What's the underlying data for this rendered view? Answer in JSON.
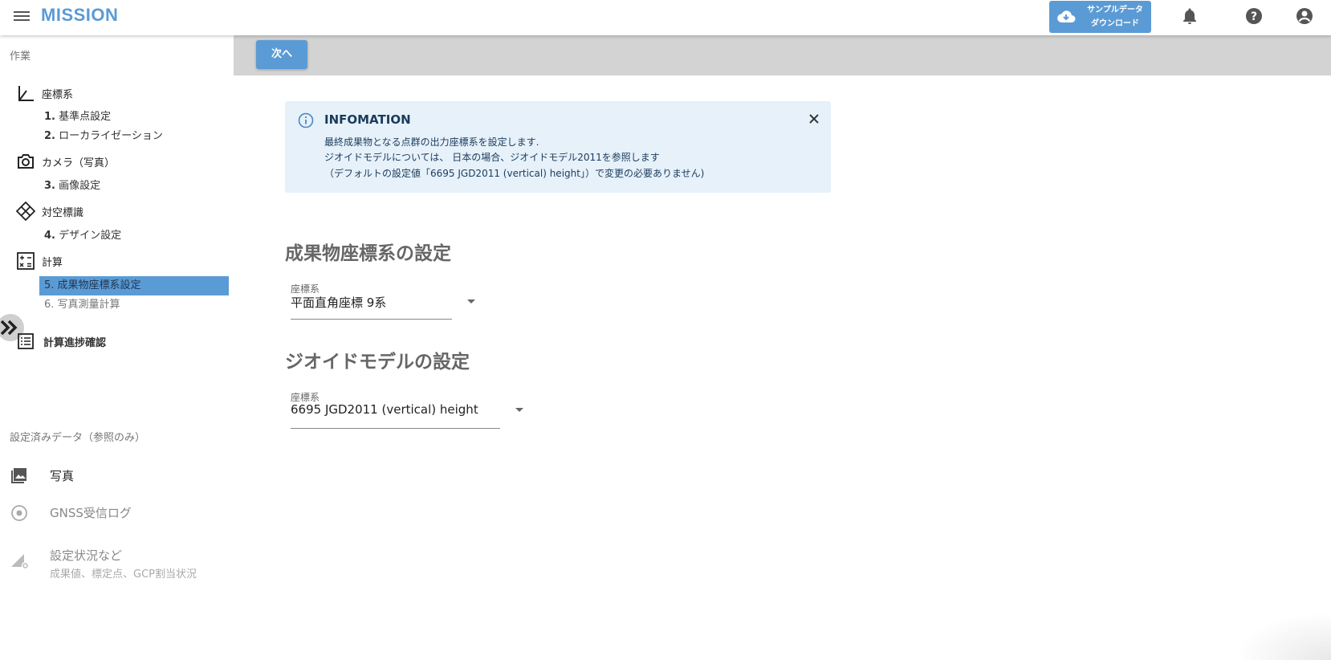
{
  "header": {
    "logo": "MISSION",
    "download_line1": "サンプルデータ",
    "download_line2": "ダウンロード",
    "icons": [
      "menu-icon",
      "cloud-download-icon",
      "bell-icon",
      "help-icon",
      "account-icon"
    ]
  },
  "sidebar": {
    "section_label": "作業",
    "groups": [
      {
        "icon": "coordinate-axes-icon",
        "label": "座標系"
      },
      {
        "icon": "camera-icon",
        "label": "カメラ（写真）"
      },
      {
        "icon": "target-marker-icon",
        "label": "対空標識"
      },
      {
        "icon": "calculator-icon",
        "label": "計算"
      }
    ],
    "steps": [
      {
        "num": "1.",
        "label": "基準点設定"
      },
      {
        "num": "2.",
        "label": "ローカライゼーション"
      },
      {
        "num": "3.",
        "label": "画像設定"
      },
      {
        "num": "4.",
        "label": "デザイン設定"
      },
      {
        "num": "5.",
        "label": "成果物座標系設定"
      },
      {
        "num": "6.",
        "label": "写真測量計算"
      }
    ],
    "progress_label": "計算進捗確認",
    "ref_section_label": "設定済みデータ（参照のみ）",
    "ref_items": [
      {
        "icon": "photo-library-icon",
        "title": "写真"
      },
      {
        "icon": "gnss-icon",
        "title": "GNSS受信ログ"
      },
      {
        "icon": "settings-status-icon",
        "title": "設定状況など",
        "subtitle": "成果値、標定点、GCP割当状況"
      }
    ]
  },
  "toolbar": {
    "next_label": "次へ"
  },
  "info": {
    "title": "INFOMATION",
    "line1": "最終成果物となる点群の出力座標系を設定します.",
    "line2": "ジオイドモデルについては、 日本の場合、ジオイドモデル2011を参照します",
    "line3": "（デフォルトの設定値「6695 JGD2011 (vertical) height」）で変更の必要ありません)"
  },
  "output_crs": {
    "heading": "成果物座標系の設定",
    "label": "座標系",
    "value": "平面直角座標 9系"
  },
  "geoid": {
    "heading": "ジオイドモデルの設定",
    "label": "座標系",
    "value": "6695 JGD2011 (vertical) height"
  },
  "colors": {
    "accent": "#5b9bd5",
    "toolbar": "#d3d3d3",
    "info_bg": "#e6f1fa"
  }
}
